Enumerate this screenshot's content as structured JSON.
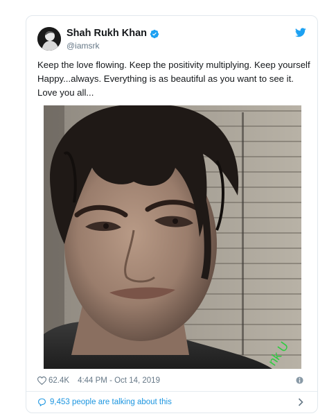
{
  "tweet": {
    "author_name": "Shah Rukh Khan",
    "author_handle": "@iamsrk",
    "text": "Keep the love flowing. Keep the positivity multiplying. Keep yourself\nHappy...always. Everything is as beautiful as you want to see it.\nLove you all...",
    "like_count": "62.4K",
    "timestamp": "4:44 PM - Oct 14, 2019",
    "talking_text": "9,453 people are talking about this",
    "media_watermark": "nk U",
    "verified": true
  },
  "icons": {
    "avatar": "avatar-silhouette",
    "verified": "verified-badge-icon",
    "brand": "twitter-bird-icon",
    "like": "heart-icon",
    "info": "info-icon",
    "talking": "chat-bubble-icon",
    "chevron": "chevron-right-icon"
  },
  "colors": {
    "accent": "#1da1f2",
    "link": "#1b95e0",
    "text": "#14171a",
    "muted": "#657786",
    "border": "#e1e8ed",
    "watermark": "#2ecc40"
  }
}
